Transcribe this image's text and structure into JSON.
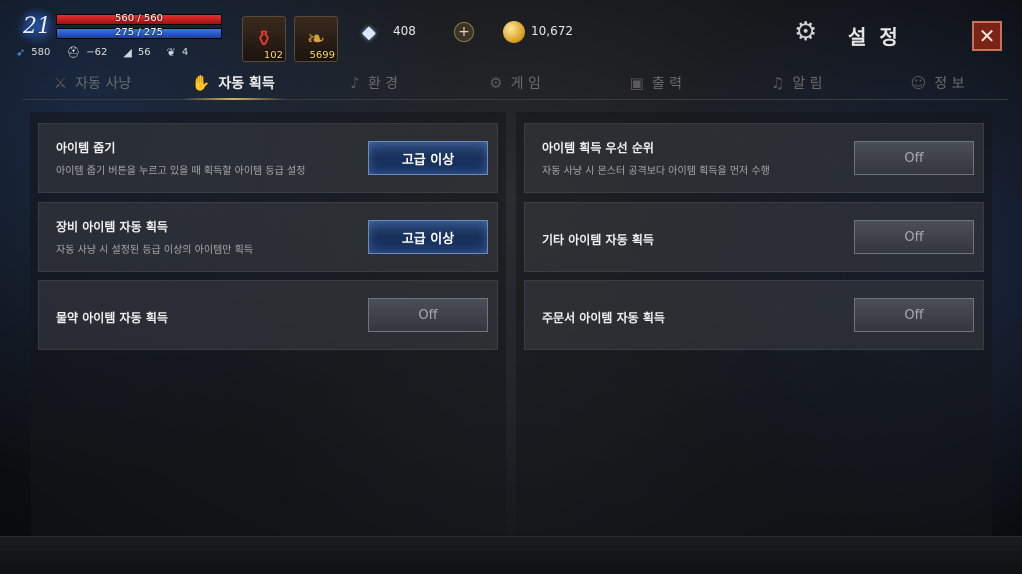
{
  "hud": {
    "level": "21",
    "hp": "560 / 560",
    "mp": "275 / 275",
    "stats": [
      {
        "icon": "speed-icon",
        "value": "580"
      },
      {
        "icon": "helmet-icon",
        "value": "−62"
      },
      {
        "icon": "boots-icon",
        "value": "56"
      },
      {
        "icon": "wings-icon",
        "value": "4"
      }
    ],
    "potion_count": "102",
    "leaf_count": "5699",
    "diamond_count": "408",
    "plus_label": "+",
    "gold_count": "10,672",
    "title": "설 정",
    "close_label": "✕"
  },
  "tabs": [
    {
      "label": "자동 사냥",
      "icon": "sword-icon",
      "active": false
    },
    {
      "label": "자동 획득",
      "icon": "pickup-icon",
      "active": true
    },
    {
      "label": "환 경",
      "icon": "music-note-icon",
      "active": false
    },
    {
      "label": "게 임",
      "icon": "gear-icon",
      "active": false
    },
    {
      "label": "출 력",
      "icon": "box-icon",
      "active": false
    },
    {
      "label": "알 림",
      "icon": "bell-icon",
      "active": false
    },
    {
      "label": "정 보",
      "icon": "user-icon",
      "active": false
    }
  ],
  "left_rows": [
    {
      "title": "아이템 줍기",
      "desc": "아이템 줍기 버튼을 누르고 있을 때 획득할 아이템 등급 설정",
      "button": "고급 이상"
    },
    {
      "title": "장비 아이템 자동 획득",
      "desc": "자동 사냥 시 설정된 등급 이상의 아이템만 획득",
      "button": "고급 이상"
    },
    {
      "title": "물약 아이템 자동 획득",
      "desc": "",
      "button": "Off"
    }
  ],
  "right_rows": [
    {
      "title": "아이템 획득 우선 순위",
      "desc": "자동 사냥 시 몬스터 공격보다 아이템 획득을 먼저 수행",
      "button": "Off"
    },
    {
      "title": "기타 아이템 자동 획득",
      "desc": "",
      "button": "Off"
    },
    {
      "title": "주문서 아이템 자동 획득",
      "desc": "",
      "button": "Off"
    }
  ],
  "colors": {
    "hp": "#e83030",
    "mp": "#3a78e8",
    "active_button": "#1a3466",
    "close_button": "#7a2418"
  }
}
